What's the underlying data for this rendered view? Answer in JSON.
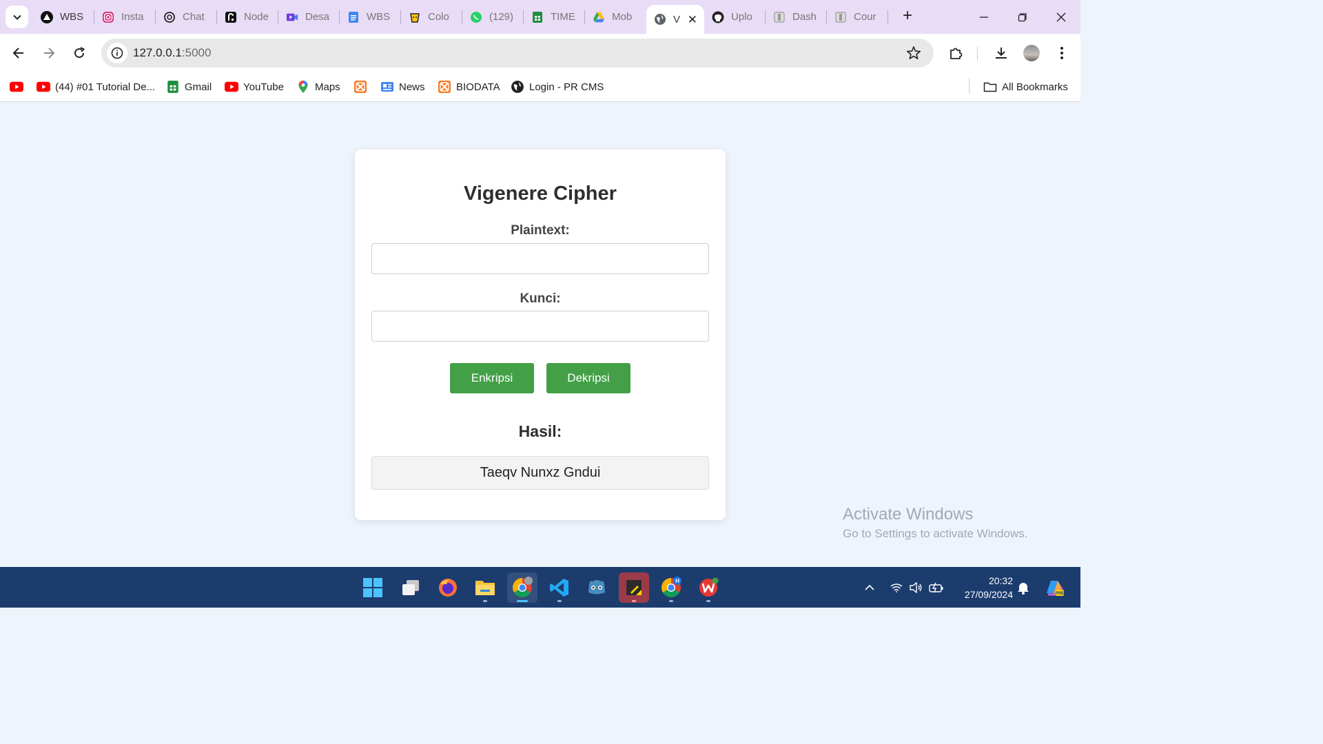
{
  "browser": {
    "tabs": [
      {
        "title": "WBS",
        "icon": "vercel-icon"
      },
      {
        "title": "Insta",
        "icon": "instagram-icon"
      },
      {
        "title": "Chat",
        "icon": "chatgpt-icon"
      },
      {
        "title": "Node",
        "icon": "render-icon"
      },
      {
        "title": "Desa",
        "icon": "video-icon"
      },
      {
        "title": "WBS",
        "icon": "docs-icon"
      },
      {
        "title": "Colo",
        "icon": "color-icon"
      },
      {
        "title": "(129)",
        "icon": "whatsapp-icon"
      },
      {
        "title": "TIME",
        "icon": "sheets-icon"
      },
      {
        "title": "Mob",
        "icon": "drive-icon"
      },
      {
        "title": "V",
        "icon": "globe-icon",
        "active": true
      },
      {
        "title": "Uplo",
        "icon": "github-icon"
      },
      {
        "title": "Dash",
        "icon": "page-icon"
      },
      {
        "title": "Cour",
        "icon": "page-icon"
      }
    ],
    "address": {
      "host": "127.0.0.1",
      "port": ":5000"
    },
    "bookmarks": [
      {
        "label": "",
        "icon": "youtube-icon"
      },
      {
        "label": "(44) #01 Tutorial De...",
        "icon": "youtube-icon"
      },
      {
        "label": "Gmail",
        "icon": "sheets-icon"
      },
      {
        "label": "YouTube",
        "icon": "youtube-icon"
      },
      {
        "label": "Maps",
        "icon": "maps-icon"
      },
      {
        "label": "",
        "icon": "xampp-icon"
      },
      {
        "label": "News",
        "icon": "news-icon"
      },
      {
        "label": "BIODATA",
        "icon": "xampp-icon"
      },
      {
        "label": "Login - PR CMS",
        "icon": "globe-icon"
      }
    ],
    "all_bookmarks": "All Bookmarks"
  },
  "app": {
    "title": "Vigenere Cipher",
    "plaintext_label": "Plaintext:",
    "plaintext_value": "",
    "key_label": "Kunci:",
    "key_value": "",
    "encrypt_label": "Enkripsi",
    "decrypt_label": "Dekripsi",
    "result_label": "Hasil:",
    "result_value": "Taeqv Nunxz Gndui"
  },
  "watermark": {
    "line1": "Activate Windows",
    "line2": "Go to Settings to activate Windows."
  },
  "taskbar": {
    "time": "20:32",
    "date": "27/09/2024"
  },
  "colors": {
    "button_green": "#43a047",
    "page_bg": "#eef4fc",
    "tabstrip_bg": "#e8dcf6",
    "taskbar_bg": "#1c3c6e"
  }
}
